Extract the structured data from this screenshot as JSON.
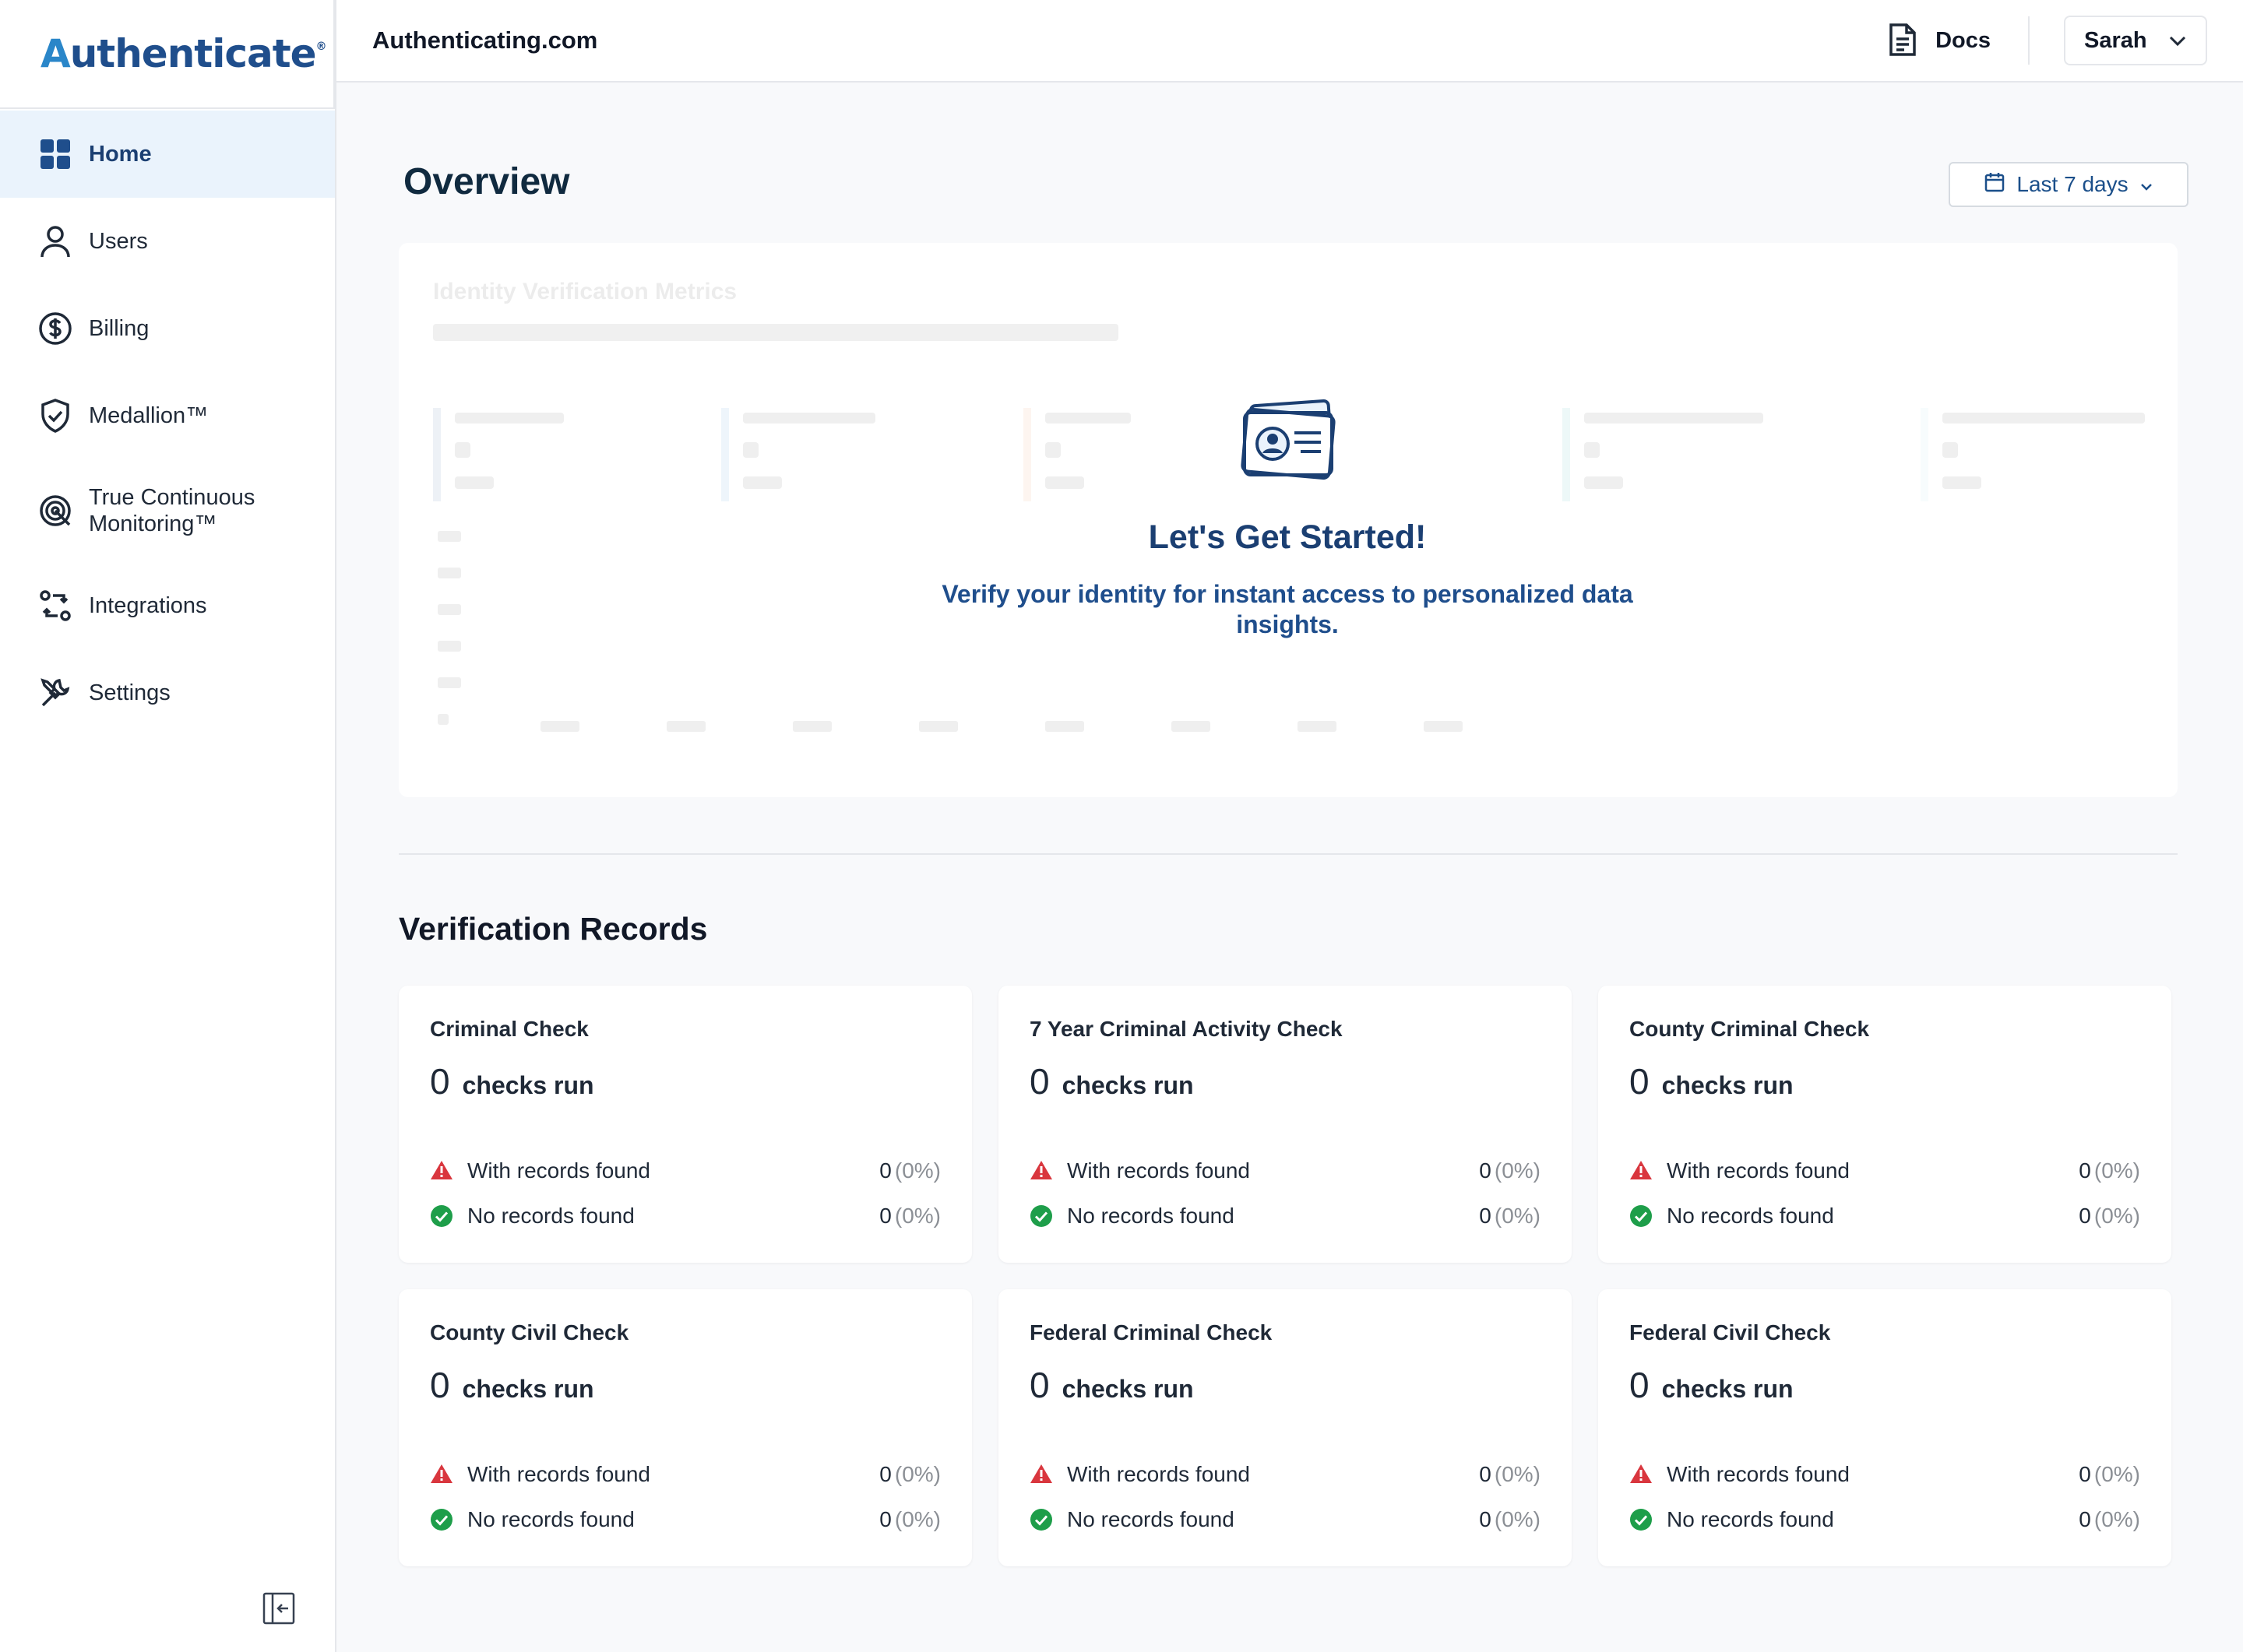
{
  "sidebar": {
    "logo": {
      "accent": "A",
      "rest": "uthenticate",
      "mark": "®"
    },
    "items": [
      {
        "label": "Home",
        "icon": "grid-icon",
        "active": true
      },
      {
        "label": "Users",
        "icon": "user-icon"
      },
      {
        "label": "Billing",
        "icon": "dollar-icon"
      },
      {
        "label": "Medallion™",
        "icon": "shield-check-icon"
      },
      {
        "label": "True Continuous Monitoring™",
        "icon": "target-icon"
      },
      {
        "label": "Integrations",
        "icon": "integrations-icon"
      },
      {
        "label": "Settings",
        "icon": "tools-icon"
      }
    ]
  },
  "topbar": {
    "site": "Authenticating.com",
    "docs_label": "Docs",
    "user_name": "Sarah"
  },
  "main": {
    "title": "Overview",
    "date_range": "Last 7 days",
    "metrics_ghost_title": "Identity Verification Metrics",
    "cta_title": "Let's Get Started!",
    "cta_text": "Verify your identity for instant access to personalized data insights."
  },
  "records": {
    "title": "Verification Records",
    "found_label": "With records found",
    "none_label": "No records found",
    "unit": "checks run",
    "cards": [
      {
        "title": "Criminal Check",
        "count": "0",
        "found": "0",
        "found_pct": "(0%)",
        "none": "0",
        "none_pct": "(0%)"
      },
      {
        "title": "7 Year Criminal Activity Check",
        "count": "0",
        "found": "0",
        "found_pct": "(0%)",
        "none": "0",
        "none_pct": "(0%)"
      },
      {
        "title": "County Criminal Check",
        "count": "0",
        "found": "0",
        "found_pct": "(0%)",
        "none": "0",
        "none_pct": "(0%)"
      },
      {
        "title": "County Civil Check",
        "count": "0",
        "found": "0",
        "found_pct": "(0%)",
        "none": "0",
        "none_pct": "(0%)"
      },
      {
        "title": "Federal Criminal Check",
        "count": "0",
        "found": "0",
        "found_pct": "(0%)",
        "none": "0",
        "none_pct": "(0%)"
      },
      {
        "title": "Federal Civil Check",
        "count": "0",
        "found": "0",
        "found_pct": "(0%)",
        "none": "0",
        "none_pct": "(0%)"
      }
    ]
  },
  "colors": {
    "brand": "#1f4e8c",
    "active_bg": "#eaf3fc",
    "warning": "#d9363e",
    "success": "#1e9e4a"
  }
}
